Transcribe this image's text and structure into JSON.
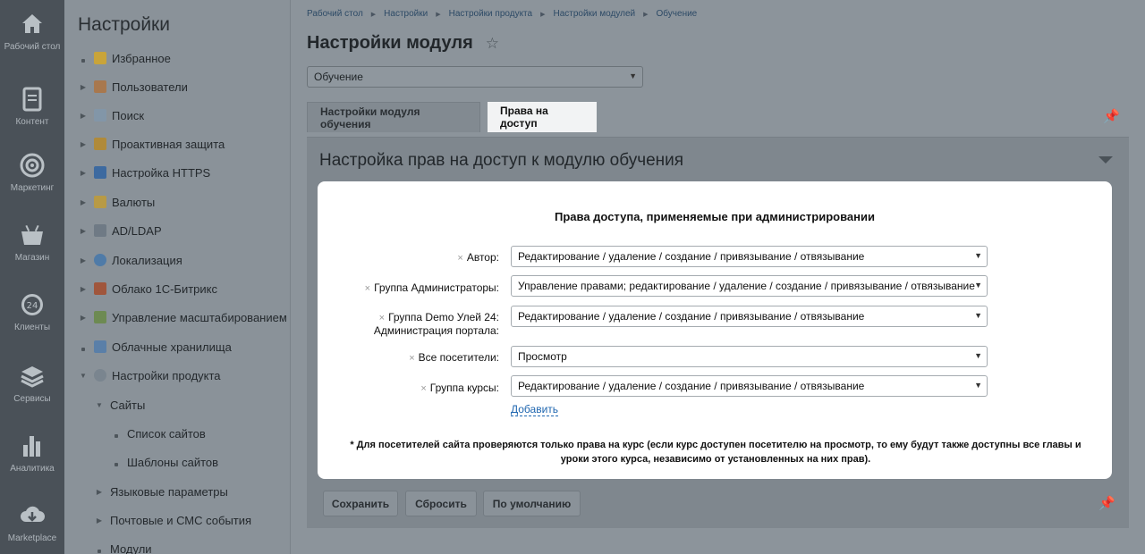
{
  "rail": [
    {
      "label": "Рабочий стол",
      "icon": "home-icon"
    },
    {
      "label": "Контент",
      "icon": "document-icon"
    },
    {
      "label": "Маркетинг",
      "icon": "target-icon"
    },
    {
      "label": "Магазин",
      "icon": "basket-icon"
    },
    {
      "label": "Клиенты",
      "icon": "clock-24-icon"
    },
    {
      "label": "Сервисы",
      "icon": "layers-icon"
    },
    {
      "label": "Аналитика",
      "icon": "bar-chart-icon"
    },
    {
      "label": "Marketplace",
      "icon": "cloud-download-icon"
    }
  ],
  "menu": {
    "title": "Настройки",
    "items": [
      {
        "label": "Избранное",
        "icon": "star-icon"
      },
      {
        "label": "Пользователи",
        "icon": "user-icon"
      },
      {
        "label": "Поиск",
        "icon": "search-icon"
      },
      {
        "label": "Проактивная защита",
        "icon": "lock-icon"
      },
      {
        "label": "Настройка HTTPS",
        "icon": "https-lock-icon"
      },
      {
        "label": "Валюты",
        "icon": "currency-icon"
      },
      {
        "label": "AD/LDAP",
        "icon": "ldap-icon"
      },
      {
        "label": "Локализация",
        "icon": "globe-icon"
      },
      {
        "label": "Облако 1С-Битрикс",
        "icon": "cloud-icon"
      },
      {
        "label": "Управление масштабированием",
        "icon": "scale-icon"
      },
      {
        "label": "Облачные хранилища",
        "icon": "storage-icon"
      },
      {
        "label": "Настройки продукта",
        "icon": "gear-icon"
      },
      {
        "label": "Сайты"
      },
      {
        "label": "Список сайтов"
      },
      {
        "label": "Шаблоны сайтов"
      },
      {
        "label": "Языковые параметры"
      },
      {
        "label": "Почтовые и СМС события"
      },
      {
        "label": "Модули"
      }
    ]
  },
  "breadcrumbs": [
    "Рабочий стол",
    "Настройки",
    "Настройки продукта",
    "Настройки модулей",
    "Обучение"
  ],
  "page_title": "Настройки модуля",
  "module_select": {
    "value": "Обучение"
  },
  "tabs": [
    {
      "label": "Настройки модуля обучения",
      "active": false
    },
    {
      "label": "Права на доступ",
      "active": true
    }
  ],
  "section": {
    "title": "Настройка прав на доступ к модулю обучения",
    "heading": "Права доступа, применяемые при администрировании",
    "rows": [
      {
        "label": "Автор:",
        "value": "Редактирование / удаление / создание / привязывание / отвязывание"
      },
      {
        "label": "Группа Администраторы:",
        "value": "Управление правами; редактирование / удаление / создание / привязывание / отвязывание"
      },
      {
        "label_line1": "Группа Demo Улей 24:",
        "label_line2": "Администрация портала:",
        "value": "Редактирование / удаление / создание / привязывание / отвязывание"
      },
      {
        "label": "Все посетители:",
        "value": "Просмотр"
      },
      {
        "label": "Группа курсы:",
        "value": "Редактирование / удаление / создание / привязывание / отвязывание"
      }
    ],
    "add_link": "Добавить",
    "note": "* Для посетителей сайта проверяются только права на курс (если курс доступен посетителю на просмотр, то ему будут также доступны все главы и уроки этого курса, независимо от установленных на них прав)."
  },
  "buttons": {
    "save": "Сохранить",
    "reset": "Сбросить",
    "default": "По умолчанию"
  },
  "colors": {
    "link": "#2067b0",
    "rail": "#4a5158",
    "overlay": "#8c949b"
  }
}
